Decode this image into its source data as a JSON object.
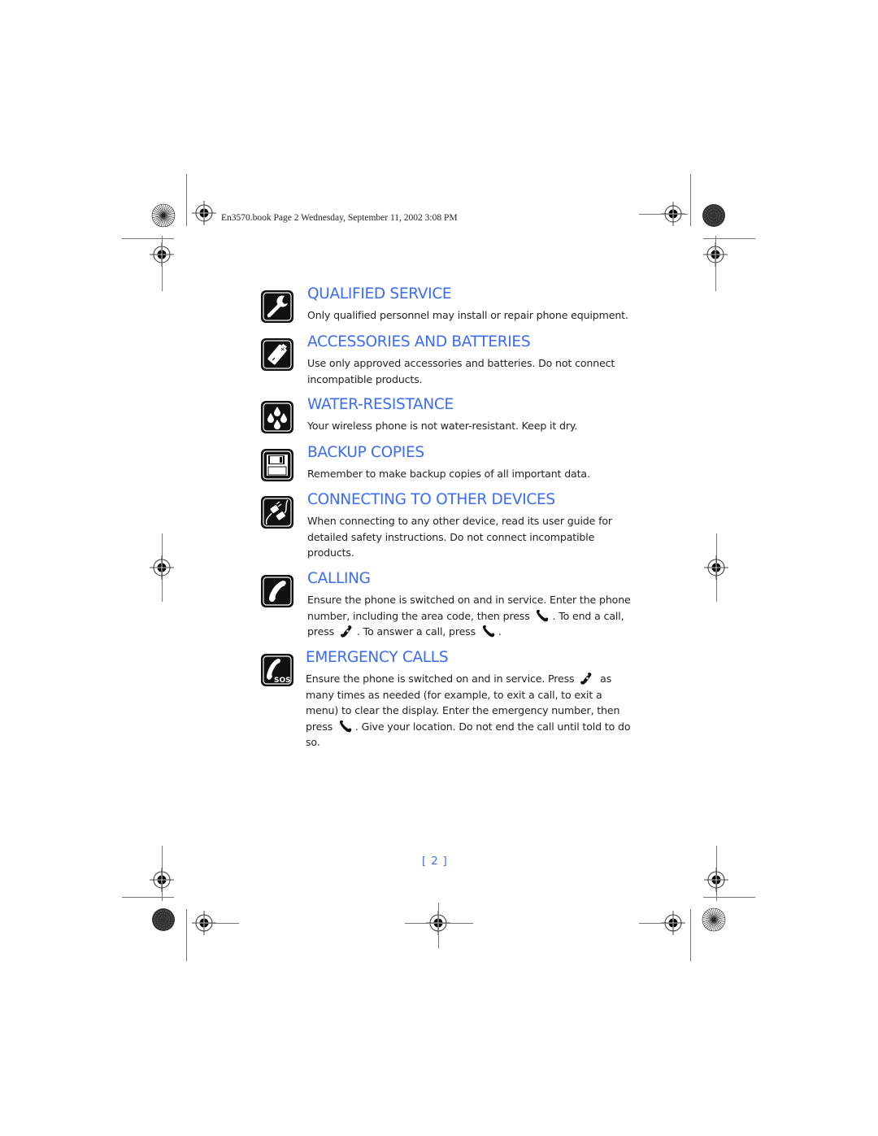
{
  "header": {
    "print_slug": "En3570.book  Page 2  Wednesday, September 11, 2002  3:08 PM"
  },
  "colors": {
    "heading": "#3b6cf5",
    "body_text": "#222222",
    "icon_bg": "#111111"
  },
  "sections": [
    {
      "title": "QUALIFIED SERVICE",
      "icon": "wrench-icon",
      "body": "Only qualified personnel may install or repair phone equipment."
    },
    {
      "title": "ACCESSORIES AND BATTERIES",
      "icon": "battery-icon",
      "body": "Use only approved accessories and batteries. Do not connect incompatible products."
    },
    {
      "title": "WATER-RESISTANCE",
      "icon": "water-drops-icon",
      "body": "Your wireless phone is not water-resistant. Keep it dry."
    },
    {
      "title": "BACKUP COPIES",
      "icon": "floppy-disk-icon",
      "body": "Remember to make backup copies of all important data."
    },
    {
      "title": "CONNECTING TO OTHER DEVICES",
      "icon": "plug-cable-icon",
      "body": "When connecting to any other device, read its user guide for detailed safety instructions. Do not connect incompatible products."
    },
    {
      "title": "CALLING",
      "icon": "phone-handset-icon",
      "body_parts": [
        "Ensure the phone is switched on and in service. Enter the phone number, including the area code, then press ",
        ". To end a call, press ",
        ". To answer a call, press ",
        "."
      ],
      "keys": [
        "talk-key-icon",
        "end-key-icon",
        "talk-key-icon"
      ]
    },
    {
      "title": "EMERGENCY CALLS",
      "icon": "sos-phone-icon",
      "body_parts": [
        "Ensure the phone is switched on and in service. Press ",
        " as many times as needed (for example, to exit a call, to exit a menu) to clear the display. Enter the emergency number, then press ",
        ". Give your location. Do not end the call until told to do so."
      ],
      "keys": [
        "end-key-icon",
        "talk-key-icon"
      ]
    }
  ],
  "footer": {
    "page_number": "[ 2 ]"
  }
}
